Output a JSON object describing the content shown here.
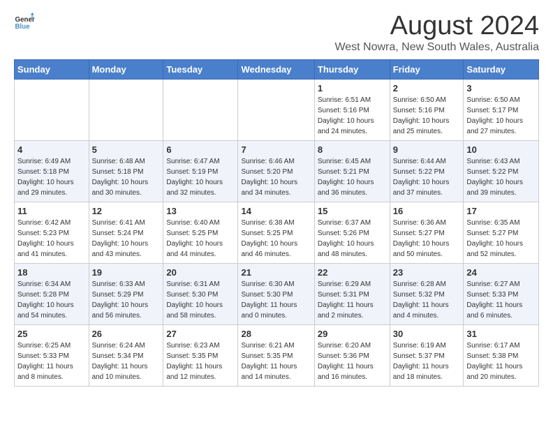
{
  "header": {
    "logo_line1": "General",
    "logo_line2": "Blue",
    "month_year": "August 2024",
    "location": "West Nowra, New South Wales, Australia"
  },
  "days_of_week": [
    "Sunday",
    "Monday",
    "Tuesday",
    "Wednesday",
    "Thursday",
    "Friday",
    "Saturday"
  ],
  "weeks": [
    [
      {
        "day": "",
        "info": ""
      },
      {
        "day": "",
        "info": ""
      },
      {
        "day": "",
        "info": ""
      },
      {
        "day": "",
        "info": ""
      },
      {
        "day": "1",
        "info": "Sunrise: 6:51 AM\nSunset: 5:16 PM\nDaylight: 10 hours\nand 24 minutes."
      },
      {
        "day": "2",
        "info": "Sunrise: 6:50 AM\nSunset: 5:16 PM\nDaylight: 10 hours\nand 25 minutes."
      },
      {
        "day": "3",
        "info": "Sunrise: 6:50 AM\nSunset: 5:17 PM\nDaylight: 10 hours\nand 27 minutes."
      }
    ],
    [
      {
        "day": "4",
        "info": "Sunrise: 6:49 AM\nSunset: 5:18 PM\nDaylight: 10 hours\nand 29 minutes."
      },
      {
        "day": "5",
        "info": "Sunrise: 6:48 AM\nSunset: 5:18 PM\nDaylight: 10 hours\nand 30 minutes."
      },
      {
        "day": "6",
        "info": "Sunrise: 6:47 AM\nSunset: 5:19 PM\nDaylight: 10 hours\nand 32 minutes."
      },
      {
        "day": "7",
        "info": "Sunrise: 6:46 AM\nSunset: 5:20 PM\nDaylight: 10 hours\nand 34 minutes."
      },
      {
        "day": "8",
        "info": "Sunrise: 6:45 AM\nSunset: 5:21 PM\nDaylight: 10 hours\nand 36 minutes."
      },
      {
        "day": "9",
        "info": "Sunrise: 6:44 AM\nSunset: 5:22 PM\nDaylight: 10 hours\nand 37 minutes."
      },
      {
        "day": "10",
        "info": "Sunrise: 6:43 AM\nSunset: 5:22 PM\nDaylight: 10 hours\nand 39 minutes."
      }
    ],
    [
      {
        "day": "11",
        "info": "Sunrise: 6:42 AM\nSunset: 5:23 PM\nDaylight: 10 hours\nand 41 minutes."
      },
      {
        "day": "12",
        "info": "Sunrise: 6:41 AM\nSunset: 5:24 PM\nDaylight: 10 hours\nand 43 minutes."
      },
      {
        "day": "13",
        "info": "Sunrise: 6:40 AM\nSunset: 5:25 PM\nDaylight: 10 hours\nand 44 minutes."
      },
      {
        "day": "14",
        "info": "Sunrise: 6:38 AM\nSunset: 5:25 PM\nDaylight: 10 hours\nand 46 minutes."
      },
      {
        "day": "15",
        "info": "Sunrise: 6:37 AM\nSunset: 5:26 PM\nDaylight: 10 hours\nand 48 minutes."
      },
      {
        "day": "16",
        "info": "Sunrise: 6:36 AM\nSunset: 5:27 PM\nDaylight: 10 hours\nand 50 minutes."
      },
      {
        "day": "17",
        "info": "Sunrise: 6:35 AM\nSunset: 5:27 PM\nDaylight: 10 hours\nand 52 minutes."
      }
    ],
    [
      {
        "day": "18",
        "info": "Sunrise: 6:34 AM\nSunset: 5:28 PM\nDaylight: 10 hours\nand 54 minutes."
      },
      {
        "day": "19",
        "info": "Sunrise: 6:33 AM\nSunset: 5:29 PM\nDaylight: 10 hours\nand 56 minutes."
      },
      {
        "day": "20",
        "info": "Sunrise: 6:31 AM\nSunset: 5:30 PM\nDaylight: 10 hours\nand 58 minutes."
      },
      {
        "day": "21",
        "info": "Sunrise: 6:30 AM\nSunset: 5:30 PM\nDaylight: 11 hours\nand 0 minutes."
      },
      {
        "day": "22",
        "info": "Sunrise: 6:29 AM\nSunset: 5:31 PM\nDaylight: 11 hours\nand 2 minutes."
      },
      {
        "day": "23",
        "info": "Sunrise: 6:28 AM\nSunset: 5:32 PM\nDaylight: 11 hours\nand 4 minutes."
      },
      {
        "day": "24",
        "info": "Sunrise: 6:27 AM\nSunset: 5:33 PM\nDaylight: 11 hours\nand 6 minutes."
      }
    ],
    [
      {
        "day": "25",
        "info": "Sunrise: 6:25 AM\nSunset: 5:33 PM\nDaylight: 11 hours\nand 8 minutes."
      },
      {
        "day": "26",
        "info": "Sunrise: 6:24 AM\nSunset: 5:34 PM\nDaylight: 11 hours\nand 10 minutes."
      },
      {
        "day": "27",
        "info": "Sunrise: 6:23 AM\nSunset: 5:35 PM\nDaylight: 11 hours\nand 12 minutes."
      },
      {
        "day": "28",
        "info": "Sunrise: 6:21 AM\nSunset: 5:35 PM\nDaylight: 11 hours\nand 14 minutes."
      },
      {
        "day": "29",
        "info": "Sunrise: 6:20 AM\nSunset: 5:36 PM\nDaylight: 11 hours\nand 16 minutes."
      },
      {
        "day": "30",
        "info": "Sunrise: 6:19 AM\nSunset: 5:37 PM\nDaylight: 11 hours\nand 18 minutes."
      },
      {
        "day": "31",
        "info": "Sunrise: 6:17 AM\nSunset: 5:38 PM\nDaylight: 11 hours\nand 20 minutes."
      }
    ]
  ]
}
